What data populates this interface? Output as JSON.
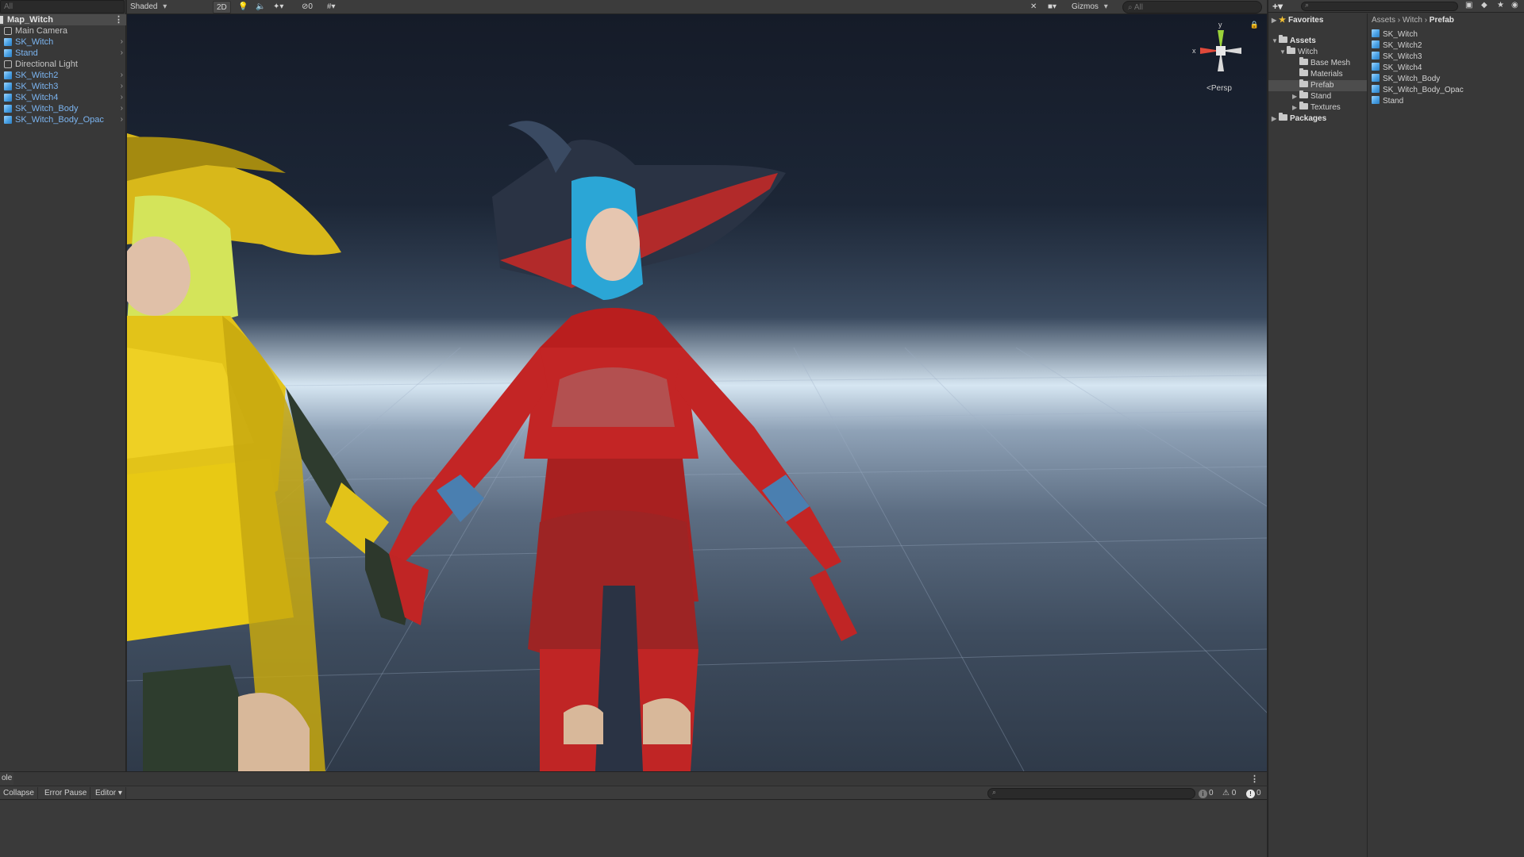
{
  "hierarchy": {
    "search_placeholder": "All",
    "scene": "Map_Witch",
    "items": [
      {
        "label": "Main Camera",
        "type": "gameobject",
        "expandable": false
      },
      {
        "label": "SK_Witch",
        "type": "prefab",
        "expandable": true
      },
      {
        "label": "Stand",
        "type": "prefab",
        "expandable": true
      },
      {
        "label": "Directional Light",
        "type": "gameobject",
        "expandable": false
      },
      {
        "label": "SK_Witch2",
        "type": "prefab",
        "expandable": true
      },
      {
        "label": "SK_Witch3",
        "type": "prefab",
        "expandable": true
      },
      {
        "label": "SK_Witch4",
        "type": "prefab",
        "expandable": true
      },
      {
        "label": "SK_Witch_Body",
        "type": "prefab",
        "expandable": true
      },
      {
        "label": "SK_Witch_Body_Opac",
        "type": "prefab",
        "expandable": true
      }
    ]
  },
  "scene_toolbar": {
    "shading_mode": "Shaded",
    "mode_2d": "2D",
    "hidden_count": "0",
    "gizmos": "Gizmos",
    "search_placeholder": "All"
  },
  "viewport": {
    "projection_label": "Persp",
    "axis_x": "x",
    "axis_y": "y",
    "colors": {
      "axis_x": "#e0493a",
      "axis_y": "#9bd23a",
      "axis_z": "#4a86e8",
      "sky_horizon": "#d6e6f2"
    }
  },
  "console": {
    "tab_label": "ole",
    "buttons": [
      "Collapse",
      "Error Pause",
      "Editor"
    ],
    "log_count": "0",
    "warning_count": "0",
    "error_count": "0"
  },
  "project": {
    "tree": {
      "favorites": "Favorites",
      "assets": "Assets",
      "witch": "Witch",
      "children": [
        "Base Mesh",
        "Materials",
        "Prefab",
        "Stand",
        "Textures"
      ],
      "packages": "Packages"
    },
    "breadcrumb": [
      "Assets",
      "Witch",
      "Prefab"
    ],
    "assets": [
      "SK_Witch",
      "SK_Witch2",
      "SK_Witch3",
      "SK_Witch4",
      "SK_Witch_Body",
      "SK_Witch_Body_Opac",
      "Stand"
    ]
  }
}
